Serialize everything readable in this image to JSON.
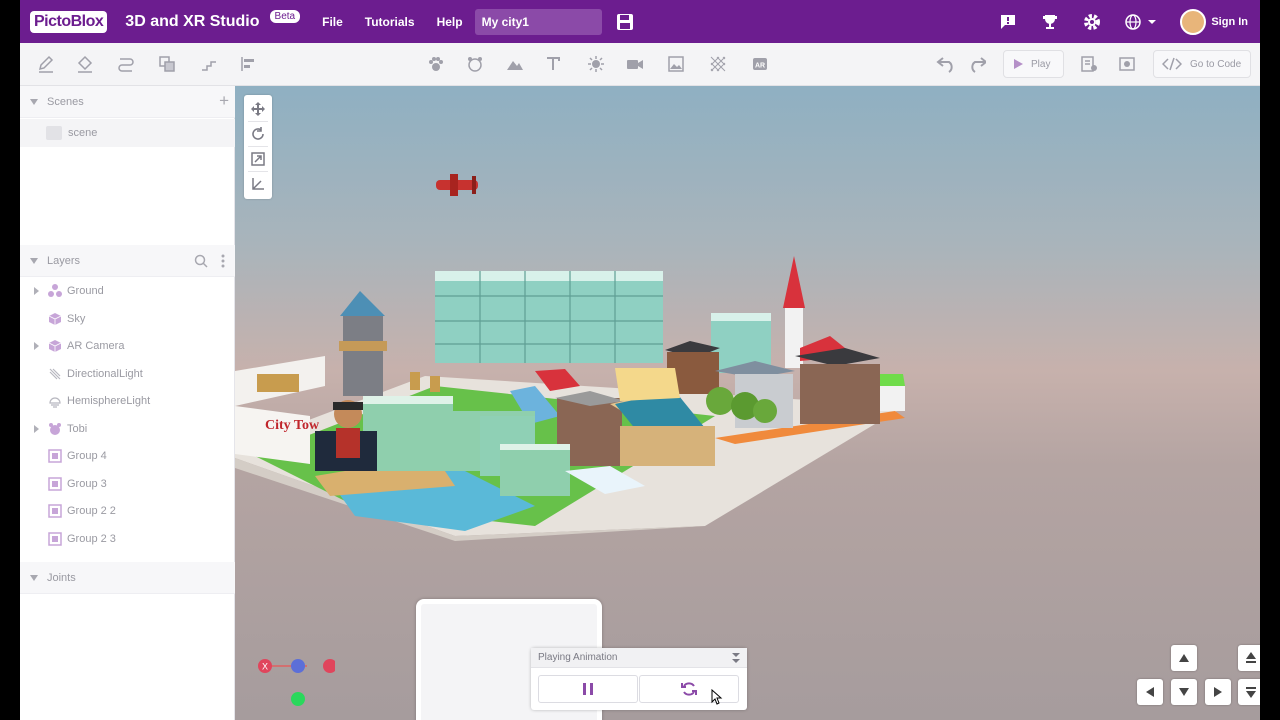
{
  "header": {
    "logo": "PictoBlox",
    "studio_title": "3D and XR Studio",
    "beta_badge": "Beta",
    "menu": [
      "File",
      "Tutorials",
      "Help"
    ],
    "project_name": "My city1",
    "sign_in": "Sign In",
    "icons": [
      "feedback-icon",
      "trophy-icon",
      "settings-gear-icon",
      "language-globe-icon",
      "save-icon"
    ]
  },
  "toolbar": {
    "play_label": "Play",
    "go_to_code_label": "Go to Code",
    "icons": [
      "pencil-icon",
      "bucket-icon",
      "path-icon",
      "copy-icon",
      "stairs-icon",
      "align-icon",
      "paw-icon",
      "bear-icon",
      "terrain-icon",
      "text-icon",
      "light-icon",
      "camera-icon",
      "image-icon",
      "texture-icon",
      "ar-icon",
      "undo-icon",
      "redo-icon",
      "settings-board-icon",
      "screenshot-icon"
    ]
  },
  "left_panel": {
    "scenes_header": "Scenes",
    "scene_item": "scene",
    "layers_header": "Layers",
    "layers": [
      {
        "label": "Ground",
        "expandable": true,
        "icon": "cube-group-icon"
      },
      {
        "label": "Sky",
        "expandable": false,
        "icon": "cube-icon"
      },
      {
        "label": "AR Camera",
        "expandable": true,
        "icon": "cube-icon"
      },
      {
        "label": "DirectionalLight",
        "expandable": false,
        "icon": "directional-light-icon"
      },
      {
        "label": "HemisphereLight",
        "expandable": false,
        "icon": "hemisphere-light-icon"
      },
      {
        "label": "Tobi",
        "expandable": true,
        "icon": "bear-icon"
      },
      {
        "label": "Group 4",
        "expandable": false,
        "icon": "group-icon"
      },
      {
        "label": "Group 3",
        "expandable": false,
        "icon": "group-icon"
      },
      {
        "label": "Group 2 2",
        "expandable": false,
        "icon": "group-icon"
      },
      {
        "label": "Group 2 3",
        "expandable": false,
        "icon": "group-icon"
      }
    ],
    "joints_header": "Joints"
  },
  "viewport": {
    "sign_text": "City Tow",
    "axis_label": "X",
    "animation_panel_title": "Playing Animation"
  },
  "colors": {
    "brand": "#6c1d8f",
    "accent": "#8b4aa8"
  }
}
